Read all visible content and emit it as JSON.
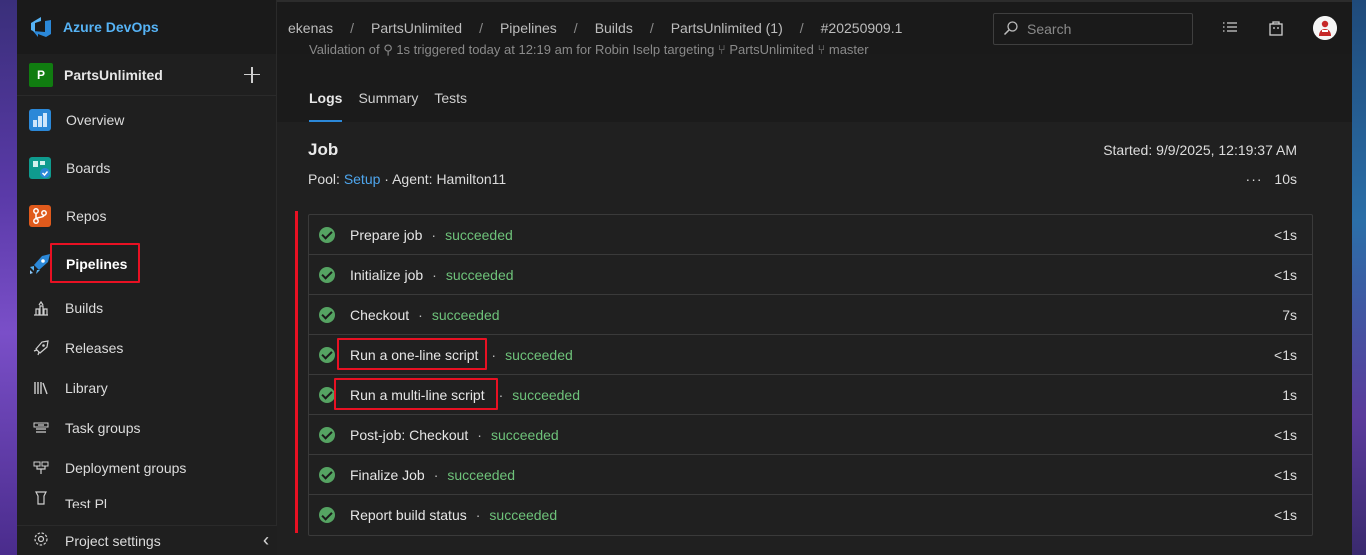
{
  "brand": {
    "name": "Azure DevOps"
  },
  "project": {
    "initial": "P",
    "name": "PartsUnlimited"
  },
  "nav": [
    {
      "label": "Overview",
      "icon": "overview-icon",
      "color": "#2b88d8"
    },
    {
      "label": "Boards",
      "icon": "boards-icon",
      "color": "#0f9b8e"
    },
    {
      "label": "Repos",
      "icon": "repos-icon",
      "color": "#e05a1c"
    },
    {
      "label": "Pipelines",
      "icon": "pipelines-icon",
      "color": "#2b88d8"
    }
  ],
  "subnav": [
    {
      "label": "Builds",
      "icon": "builds-icon"
    },
    {
      "label": "Releases",
      "icon": "releases-icon"
    },
    {
      "label": "Library",
      "icon": "library-icon"
    },
    {
      "label": "Task groups",
      "icon": "task-groups-icon"
    },
    {
      "label": "Deployment groups",
      "icon": "deployment-groups-icon"
    },
    {
      "label": "Test Pl",
      "icon": "test-plans-icon"
    }
  ],
  "footer": {
    "settings_label": "Project settings"
  },
  "breadcrumbs": [
    "ekenas",
    "PartsUnlimited",
    "Pipelines",
    "Builds",
    "PartsUnlimited (1)",
    "#20250909.1"
  ],
  "search": {
    "placeholder": "Search"
  },
  "header_cut_text": "Validation of  ⚲ 1s triggered today at 12:19 am for Robin Iselp targeting   ⑂ PartsUnlimited  ⑂  master",
  "tabs": [
    "Logs",
    "Summary",
    "Tests"
  ],
  "job": {
    "title": "Job",
    "started": "Started: 9/9/2025, 12:19:37 AM",
    "pool_label": "Pool:",
    "pool_link": "Setup",
    "agent": "· Agent: Hamilton11",
    "duration_dots": "···",
    "duration": "10s"
  },
  "steps": [
    {
      "name": "Prepare job",
      "status": "succeeded",
      "duration": "<1s"
    },
    {
      "name": "Initialize job",
      "status": "succeeded",
      "duration": "<1s"
    },
    {
      "name": "Checkout",
      "status": "succeeded",
      "duration": "7s"
    },
    {
      "name": "Run a one-line script",
      "status": "succeeded",
      "duration": "<1s"
    },
    {
      "name": "Run a multi-line script",
      "status": "succeeded",
      "duration": "1s"
    },
    {
      "name": "Post-job: Checkout",
      "status": "succeeded",
      "duration": "<1s"
    },
    {
      "name": "Finalize Job",
      "status": "succeeded",
      "duration": "<1s"
    },
    {
      "name": "Report build status",
      "status": "succeeded",
      "duration": "<1s"
    }
  ],
  "colors": {
    "accent": "#2b88d8",
    "success": "#55a362",
    "highlight": "#e81123"
  }
}
